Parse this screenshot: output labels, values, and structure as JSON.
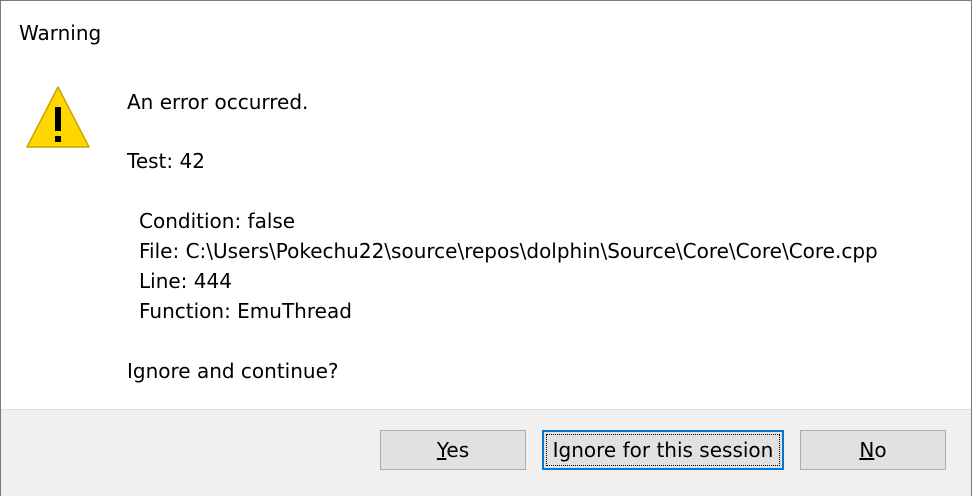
{
  "dialog": {
    "title": "Warning",
    "icon": "warning-triangle-icon",
    "message": "An error occurred.",
    "test_line": "Test: 42",
    "details": {
      "condition": "Condition: false",
      "file": "File: C:\\Users\\Pokechu22\\source\\repos\\dolphin\\Source\\Core\\Core\\Core.cpp",
      "line": "Line: 444",
      "function": "Function: EmuThread"
    },
    "question": "Ignore and continue?"
  },
  "buttons": {
    "yes": {
      "mnemonic": "Y",
      "rest": "es"
    },
    "ignore_session": "Ignore for this session",
    "no": {
      "mnemonic": "N",
      "rest": "o"
    }
  },
  "colors": {
    "icon_fill": "#FFD700",
    "focus_border": "#0078d7",
    "footer_bg": "#f0f0f0"
  }
}
